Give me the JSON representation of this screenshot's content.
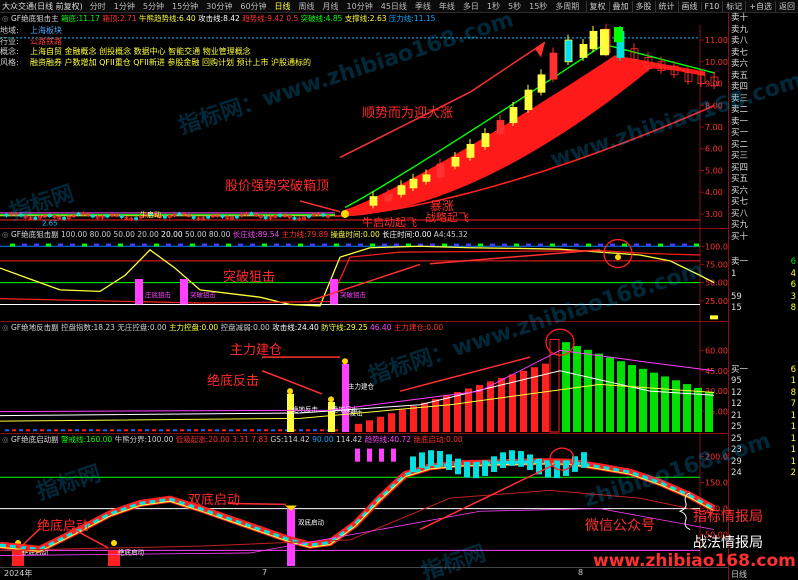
{
  "toolbar": {
    "product_name": "大众交通(日线 前复权)",
    "timeframes": [
      "分时",
      "1分钟",
      "5分钟",
      "15分钟",
      "30分钟",
      "60分钟",
      "日线",
      "周线",
      "月线",
      "10分钟",
      "45日线",
      "季线",
      "年线",
      "多日",
      "1秒",
      "5秒",
      "15秒",
      "多周期",
      "更多"
    ],
    "active_timeframe": "日线",
    "right_buttons": [
      "复权",
      "叠加",
      "多股",
      "统计",
      "画线",
      "F10",
      "标记",
      "+自选",
      "返回"
    ]
  },
  "main_indicator": {
    "name": "GF绝底狙击主",
    "fields": [
      {
        "label": "箱底",
        "value": "11.17",
        "color": "#00ff00"
      },
      {
        "label": "箱顶",
        "value": "2.71",
        "color": "#ff3030"
      },
      {
        "label": "牛熊趋势线",
        "value": "6.40",
        "color": "#ffff3c"
      },
      {
        "label": "攻击线",
        "value": "8.42",
        "color": "#ffffff"
      },
      {
        "label": "趋势线",
        "value": "9.42",
        "color": "#ff3030"
      },
      {
        "label": "0.5",
        "value": "",
        "color": "#ff3030"
      },
      {
        "label": "突破线",
        "value": "4.85",
        "color": "#00ff00"
      },
      {
        "label": "支撑线",
        "value": "2.63",
        "color": "#ffff3c"
      },
      {
        "label": "压力线",
        "value": "11.15",
        "color": "#00aaff"
      }
    ]
  },
  "stock_info": [
    {
      "k": "地域:",
      "v": "上海板块",
      "c": "blue"
    },
    {
      "k": "行业:",
      "v": "公路铁路",
      "c": "red"
    },
    {
      "k": "概念:",
      "v": "上海自贸 金融概念 创投概念 数据中心 智能交通 物业管理概念",
      "c": "yellow"
    },
    {
      "k": "风格:",
      "v": "融资融券 户数增加 QFII重仓 QFII新进 参股金融 回购计划 预计上市 沪股通标的",
      "c": "yellow"
    }
  ],
  "price_axis": [
    "11.00",
    "10.00",
    "9.00",
    "8.00",
    "7.00",
    "6.00",
    "5.00",
    "4.00",
    "3.00"
  ],
  "main_annotations": {
    "uptrend": "顺势而为迎大涨",
    "breakout": "股价强势突破箱顶",
    "surge": "暴涨",
    "start": "牛启动起飞",
    "launch": "战略起飞",
    "box_label": "牛启动",
    "last_price_label": "2.65"
  },
  "sniper_indicator": {
    "name": "GF绝底狙击副",
    "fields": [
      {
        "label": "",
        "value": "100.00",
        "color": "#ccc"
      },
      {
        "label": "",
        "value": "80.00",
        "color": "#ccc"
      },
      {
        "label": "",
        "value": "50.00",
        "color": "#ccc"
      },
      {
        "label": "",
        "value": "20.00",
        "color": "#ccc"
      },
      {
        "label": "",
        "value": "20.00",
        "color": "#fff"
      },
      {
        "label": "",
        "value": "50.00",
        "color": "#ccc"
      },
      {
        "label": "",
        "value": "80.00",
        "color": "#ccc"
      },
      {
        "label": "长庄线",
        "value": "89.54",
        "color": "#ff40ff"
      },
      {
        "label": "主力线",
        "value": "79.89",
        "color": "#ff3030"
      },
      {
        "label": "操盘时间",
        "value": "0.00",
        "color": "#ffff3c"
      },
      {
        "label": "长庄时间",
        "value": "0.00",
        "color": "#ffffff"
      },
      {
        "label": "A4",
        "value": "45.32",
        "color": "#ccc"
      }
    ],
    "annotation": "突破狙击",
    "label_a": "庄底狙击",
    "label_b": "突破狙击",
    "axis": [
      "100.0",
      "75.00",
      "50.00",
      "25.00"
    ]
  },
  "control_indicator": {
    "name": "GF绝地反击副",
    "fields": [
      {
        "label": "控盘指数",
        "value": "18.23",
        "color": "#ccc"
      },
      {
        "label": "无庄控盘",
        "value": "0.00",
        "color": "#ccc"
      },
      {
        "label": "主力控盘",
        "value": "0.00",
        "color": "#ffff3c"
      },
      {
        "label": "控盘减弱",
        "value": "0.00",
        "color": "#ccc"
      },
      {
        "label": "攻击线",
        "value": "24.40",
        "color": "#ffffff"
      },
      {
        "label": "防守线",
        "value": "29.25",
        "color": "#ffff3c"
      },
      {
        "label": "",
        "value": "46.40",
        "color": "#ff40ff"
      },
      {
        "label": "主力建仓",
        "value": "0.00",
        "color": "#ff3030"
      }
    ],
    "annotation_build": "主力建仓",
    "annotation_counter": "绝底反击",
    "label_counter": "绝地反击",
    "label_build": "主力建仓",
    "label_attack": "反击",
    "axis": [
      "60.00",
      "45.00",
      "30.00",
      "15.00"
    ]
  },
  "start_indicator": {
    "name": "GF绝底启动副",
    "fields": [
      {
        "label": "警戒线",
        "value": "160.00",
        "color": "#00ff00"
      },
      {
        "label": "牛熊分界",
        "value": "100.00",
        "color": "#ccc"
      },
      {
        "label": "低吸起涨",
        "value": "20.00",
        "color": "#ff3030"
      },
      {
        "label": "",
        "value": "3.31",
        "color": "#ff3030"
      },
      {
        "label": "",
        "value": "7.83",
        "color": "#ff3030"
      },
      {
        "label": "GS",
        "value": "114.42",
        "color": "#ccc"
      },
      {
        "label": "",
        "value": "90.00",
        "color": "#00aaff"
      },
      {
        "label": "",
        "value": "114.42",
        "color": "#ccc"
      },
      {
        "label": "趋势线",
        "value": "40.72",
        "color": "#ff40ff"
      },
      {
        "label": "绝底启动",
        "value": "0.00",
        "color": "#ff3030"
      }
    ],
    "annotation_double": "双底启动",
    "annotation_bottom": "绝底启动",
    "label_double": "双底启动",
    "label_bottom_a": "绝底启动",
    "label_bottom_b": "绝底启动",
    "axis": [
      "200.0",
      "150.0",
      "100.0",
      "50.00"
    ]
  },
  "x_axis": [
    "2024年",
    "7",
    "8"
  ],
  "right_panel": {
    "sell_levels": [
      "卖十",
      "卖九",
      "卖八",
      "卖七",
      "卖六",
      "卖五",
      "卖四",
      "卖三",
      "卖二",
      "卖一"
    ],
    "buy_levels": [
      "买一",
      "买二",
      "买三",
      "买四",
      "买五",
      "买六",
      "买七",
      "买八",
      "买九",
      "买十"
    ],
    "mid_rows": [
      {
        "lbl": "卖一",
        "num": "6",
        "g": true
      },
      {
        "lbl": "1",
        "num": "4"
      },
      {
        "lbl": "",
        "num": "6"
      },
      {
        "lbl": "59",
        "num": "3"
      },
      {
        "lbl": "15",
        "num": "8"
      }
    ],
    "buy_rows": [
      {
        "lbl": "买一",
        "num": "6"
      },
      {
        "lbl": "95",
        "num": "1"
      },
      {
        "lbl": "12",
        "num": "8"
      },
      {
        "lbl": "12",
        "num": "7"
      },
      {
        "lbl": "21",
        "num": "1"
      },
      {
        "lbl": "25",
        "num": "1"
      },
      {
        "lbl": "25",
        "num": "1"
      },
      {
        "lbl": "23",
        "num": "1"
      },
      {
        "lbl": "29",
        "num": "1"
      },
      {
        "lbl": "24",
        "num": "2"
      }
    ],
    "bottom_tab": "日线"
  },
  "watermarks": [
    "指标网：www.zhibiao168.com",
    "指标网",
    "指标网",
    "指标网",
    "www.zhibiao168.com",
    "zhibiao168.com",
    "指标网：www.zhibiao168.com"
  ],
  "promo": {
    "wechat": "微信公众号",
    "brand1": "指标情报局",
    "brand2": "战法情报局",
    "url": "www.zhibiao168.com"
  }
}
